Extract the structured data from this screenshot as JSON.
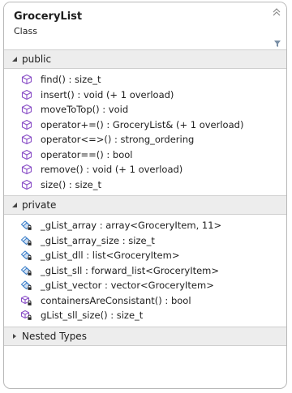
{
  "header": {
    "title": "GroceryList",
    "subtitle": "Class"
  },
  "sections": {
    "public": {
      "label": "public",
      "items": [
        "find() : size_t",
        "insert() : void (+ 1 overload)",
        "moveToTop() : void",
        "operator+=() : GroceryList& (+ 1 overload)",
        "operator<=>() : strong_ordering",
        "operator==() : bool",
        "remove() : void (+ 1 overload)",
        "size() : size_t"
      ]
    },
    "private": {
      "label": "private",
      "items": [
        "_gList_array : array<GroceryItem, 11>",
        "_gList_array_size : size_t",
        "_gList_dll : list<GroceryItem>",
        "_gList_sll : forward_list<GroceryItem>",
        "_gList_vector : vector<GroceryItem>",
        "containersAreConsistant() : bool",
        "gList_sll_size() : size_t"
      ]
    },
    "nested": {
      "label": "Nested Types"
    }
  },
  "colors": {
    "method_icon": "#8a4fc7",
    "field_icon": "#3c7fc9",
    "lock": "#222222"
  },
  "icons": {
    "collapse": "double-chevron-up-icon",
    "filter": "filter-icon",
    "method": "method-cube-icon",
    "private_field": "private-field-icon",
    "private_method": "private-method-icon"
  }
}
